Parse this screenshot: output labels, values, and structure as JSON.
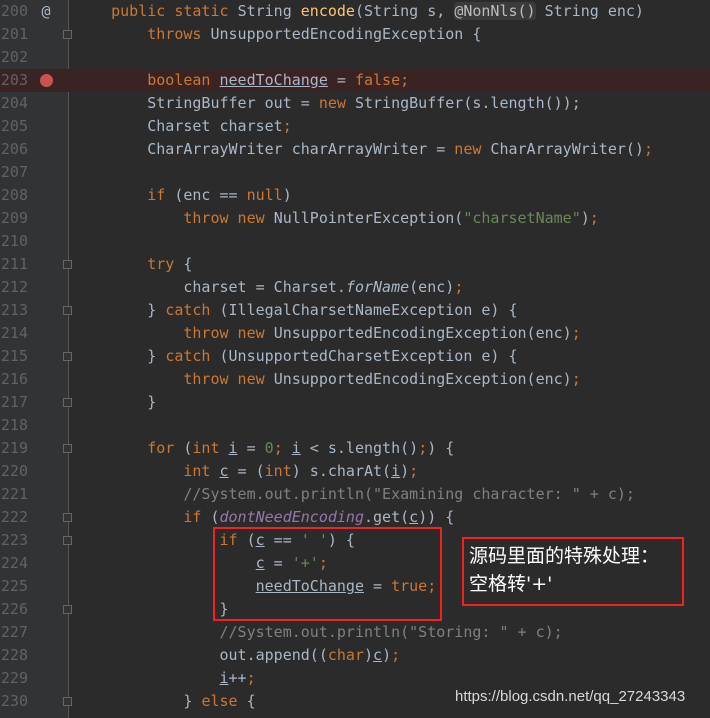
{
  "editor": {
    "colors": {
      "background": "#2b2b2b",
      "keyword": "#cc7832",
      "string": "#6a8759",
      "comment": "#808080",
      "field": "#9876aa",
      "method": "#ffc66d",
      "breakpoint": "#c75450"
    },
    "breakpoint_line": 203,
    "override_icon_line": 200,
    "override_icon": "@",
    "fold_lines": [
      201,
      211,
      213,
      215,
      217,
      219,
      222,
      223,
      226,
      230
    ],
    "lines": [
      {
        "n": 200,
        "t": [
          [
            "p",
            "    "
          ],
          [
            "k",
            "public static "
          ],
          [
            "p",
            "String "
          ],
          [
            "m",
            "encode"
          ],
          [
            "p",
            "(String s, "
          ],
          [
            "a",
            "@NonNls()"
          ],
          [
            "p",
            " String enc)"
          ]
        ]
      },
      {
        "n": 201,
        "t": [
          [
            "p",
            "        "
          ],
          [
            "k",
            "throws "
          ],
          [
            "p",
            "UnsupportedEncodingException {"
          ]
        ]
      },
      {
        "n": 202,
        "t": []
      },
      {
        "n": 203,
        "t": [
          [
            "p",
            "        "
          ],
          [
            "k",
            "boolean "
          ],
          [
            "u",
            "needToChange"
          ],
          [
            "p",
            " = "
          ],
          [
            "k",
            "false;"
          ]
        ]
      },
      {
        "n": 204,
        "t": [
          [
            "p",
            "        StringBuffer out = "
          ],
          [
            "k",
            "new "
          ],
          [
            "p",
            "StringBuffer(s.length());"
          ]
        ]
      },
      {
        "n": 205,
        "t": [
          [
            "p",
            "        Charset charset"
          ],
          [
            "k",
            ";"
          ]
        ]
      },
      {
        "n": 206,
        "t": [
          [
            "p",
            "        CharArrayWriter charArrayWriter = "
          ],
          [
            "k",
            "new "
          ],
          [
            "p",
            "CharArrayWriter()"
          ],
          [
            "k",
            ";"
          ]
        ]
      },
      {
        "n": 207,
        "t": []
      },
      {
        "n": 208,
        "t": [
          [
            "p",
            "        "
          ],
          [
            "k",
            "if "
          ],
          [
            "p",
            "(enc == "
          ],
          [
            "k",
            "null"
          ],
          [
            "p",
            ")"
          ]
        ]
      },
      {
        "n": 209,
        "t": [
          [
            "p",
            "            "
          ],
          [
            "k",
            "throw new "
          ],
          [
            "p",
            "NullPointerException("
          ],
          [
            "s",
            "\"charsetName\""
          ],
          [
            "p",
            ")"
          ],
          [
            "k",
            ";"
          ]
        ]
      },
      {
        "n": 210,
        "t": []
      },
      {
        "n": 211,
        "t": [
          [
            "p",
            "        "
          ],
          [
            "k",
            "try "
          ],
          [
            "p",
            "{"
          ]
        ]
      },
      {
        "n": 212,
        "t": [
          [
            "p",
            "            charset = Charset."
          ],
          [
            "i",
            "forName"
          ],
          [
            "p",
            "(enc)"
          ],
          [
            "k",
            ";"
          ]
        ]
      },
      {
        "n": 213,
        "t": [
          [
            "p",
            "        } "
          ],
          [
            "k",
            "catch "
          ],
          [
            "p",
            "(IllegalCharsetNameException e) {"
          ]
        ]
      },
      {
        "n": 214,
        "t": [
          [
            "p",
            "            "
          ],
          [
            "k",
            "throw new "
          ],
          [
            "p",
            "UnsupportedEncodingException(enc)"
          ],
          [
            "k",
            ";"
          ]
        ]
      },
      {
        "n": 215,
        "t": [
          [
            "p",
            "        } "
          ],
          [
            "k",
            "catch "
          ],
          [
            "p",
            "(UnsupportedCharsetException e) {"
          ]
        ]
      },
      {
        "n": 216,
        "t": [
          [
            "p",
            "            "
          ],
          [
            "k",
            "throw new "
          ],
          [
            "p",
            "UnsupportedEncodingException(enc)"
          ],
          [
            "k",
            ";"
          ]
        ]
      },
      {
        "n": 217,
        "t": [
          [
            "p",
            "        }"
          ]
        ]
      },
      {
        "n": 218,
        "t": []
      },
      {
        "n": 219,
        "t": [
          [
            "p",
            "        "
          ],
          [
            "k",
            "for "
          ],
          [
            "p",
            "("
          ],
          [
            "k",
            "int "
          ],
          [
            "u",
            "i"
          ],
          [
            "p",
            " = "
          ],
          [
            "s",
            "0"
          ],
          [
            "k",
            "; "
          ],
          [
            "u",
            "i"
          ],
          [
            "p",
            " < s.length()"
          ],
          [
            "k",
            ";"
          ],
          [
            "p",
            ") {"
          ]
        ]
      },
      {
        "n": 220,
        "t": [
          [
            "p",
            "            "
          ],
          [
            "k",
            "int "
          ],
          [
            "u",
            "c"
          ],
          [
            "p",
            " = ("
          ],
          [
            "k",
            "int"
          ],
          [
            "p",
            ") s.charAt("
          ],
          [
            "u",
            "i"
          ],
          [
            "p",
            ")"
          ],
          [
            "k",
            ";"
          ]
        ]
      },
      {
        "n": 221,
        "t": [
          [
            "c",
            "            //System.out.println(\"Examining character: \" + c);"
          ]
        ]
      },
      {
        "n": 222,
        "t": [
          [
            "p",
            "            "
          ],
          [
            "k",
            "if "
          ],
          [
            "p",
            "("
          ],
          [
            "f",
            "dontNeedEncoding"
          ],
          [
            "p",
            ".get("
          ],
          [
            "u",
            "c"
          ],
          [
            "p",
            ")) {"
          ]
        ]
      },
      {
        "n": 223,
        "t": [
          [
            "p",
            "                "
          ],
          [
            "k",
            "if "
          ],
          [
            "p",
            "("
          ],
          [
            "u",
            "c"
          ],
          [
            "p",
            " == "
          ],
          [
            "s",
            "' '"
          ],
          [
            "p",
            ") {"
          ]
        ]
      },
      {
        "n": 224,
        "t": [
          [
            "p",
            "                    "
          ],
          [
            "u",
            "c"
          ],
          [
            "p",
            " = "
          ],
          [
            "s",
            "'+'"
          ],
          [
            "k",
            ";"
          ]
        ]
      },
      {
        "n": 225,
        "t": [
          [
            "p",
            "                    "
          ],
          [
            "u",
            "needToChange"
          ],
          [
            "p",
            " = "
          ],
          [
            "k",
            "true;"
          ]
        ]
      },
      {
        "n": 226,
        "t": [
          [
            "p",
            "                }"
          ]
        ]
      },
      {
        "n": 227,
        "t": [
          [
            "c",
            "                //System.out.println(\"Storing: \" + c);"
          ]
        ]
      },
      {
        "n": 228,
        "t": [
          [
            "p",
            "                out.append(("
          ],
          [
            "k",
            "char"
          ],
          [
            "p",
            ")"
          ],
          [
            "u",
            "c"
          ],
          [
            "p",
            ")"
          ],
          [
            "k",
            ";"
          ]
        ]
      },
      {
        "n": 229,
        "t": [
          [
            "p",
            "                "
          ],
          [
            "u",
            "i"
          ],
          [
            "p",
            "++"
          ],
          [
            "k",
            ";"
          ]
        ]
      },
      {
        "n": 230,
        "t": [
          [
            "p",
            "            } "
          ],
          [
            "k",
            "else "
          ],
          [
            "p",
            "{"
          ]
        ]
      }
    ]
  },
  "annotation": {
    "line1": "源码里面的特殊处理：",
    "line2": "空格转'+'",
    "border_color": "#f5211f"
  },
  "watermark": "https://blog.csdn.net/qq_27243343"
}
